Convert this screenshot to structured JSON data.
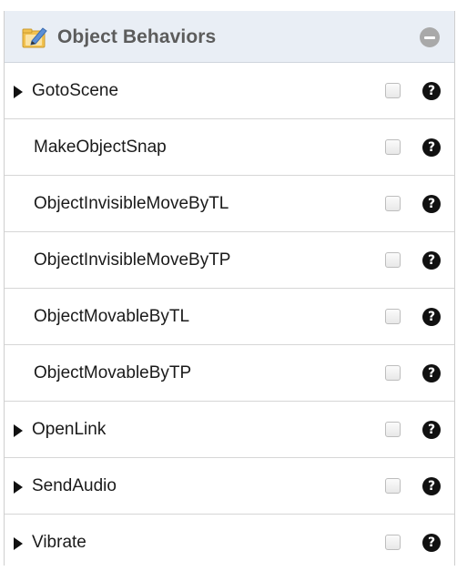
{
  "panel": {
    "title": "Object Behaviors",
    "header_icon": "edit-folder-icon",
    "collapse_icon": "minus-circle-icon"
  },
  "rows": [
    {
      "label": "GotoScene",
      "has_expander": true,
      "checked": false,
      "help_glyph": "?"
    },
    {
      "label": "MakeObjectSnap",
      "has_expander": false,
      "checked": false,
      "help_glyph": "?"
    },
    {
      "label": "ObjectInvisibleMoveByTL",
      "has_expander": false,
      "checked": false,
      "help_glyph": "?"
    },
    {
      "label": "ObjectInvisibleMoveByTP",
      "has_expander": false,
      "checked": false,
      "help_glyph": "?"
    },
    {
      "label": "ObjectMovableByTL",
      "has_expander": false,
      "checked": false,
      "help_glyph": "?"
    },
    {
      "label": "ObjectMovableByTP",
      "has_expander": false,
      "checked": false,
      "help_glyph": "?"
    },
    {
      "label": "OpenLink",
      "has_expander": true,
      "checked": false,
      "help_glyph": "?"
    },
    {
      "label": "SendAudio",
      "has_expander": true,
      "checked": false,
      "help_glyph": "?"
    },
    {
      "label": "Vibrate",
      "has_expander": true,
      "checked": false,
      "help_glyph": "?"
    }
  ],
  "colors": {
    "header_bg": "#e9eef5",
    "title_text": "#5c5c5c",
    "row_divider": "#d6d6d6",
    "help_icon": "#111111"
  }
}
